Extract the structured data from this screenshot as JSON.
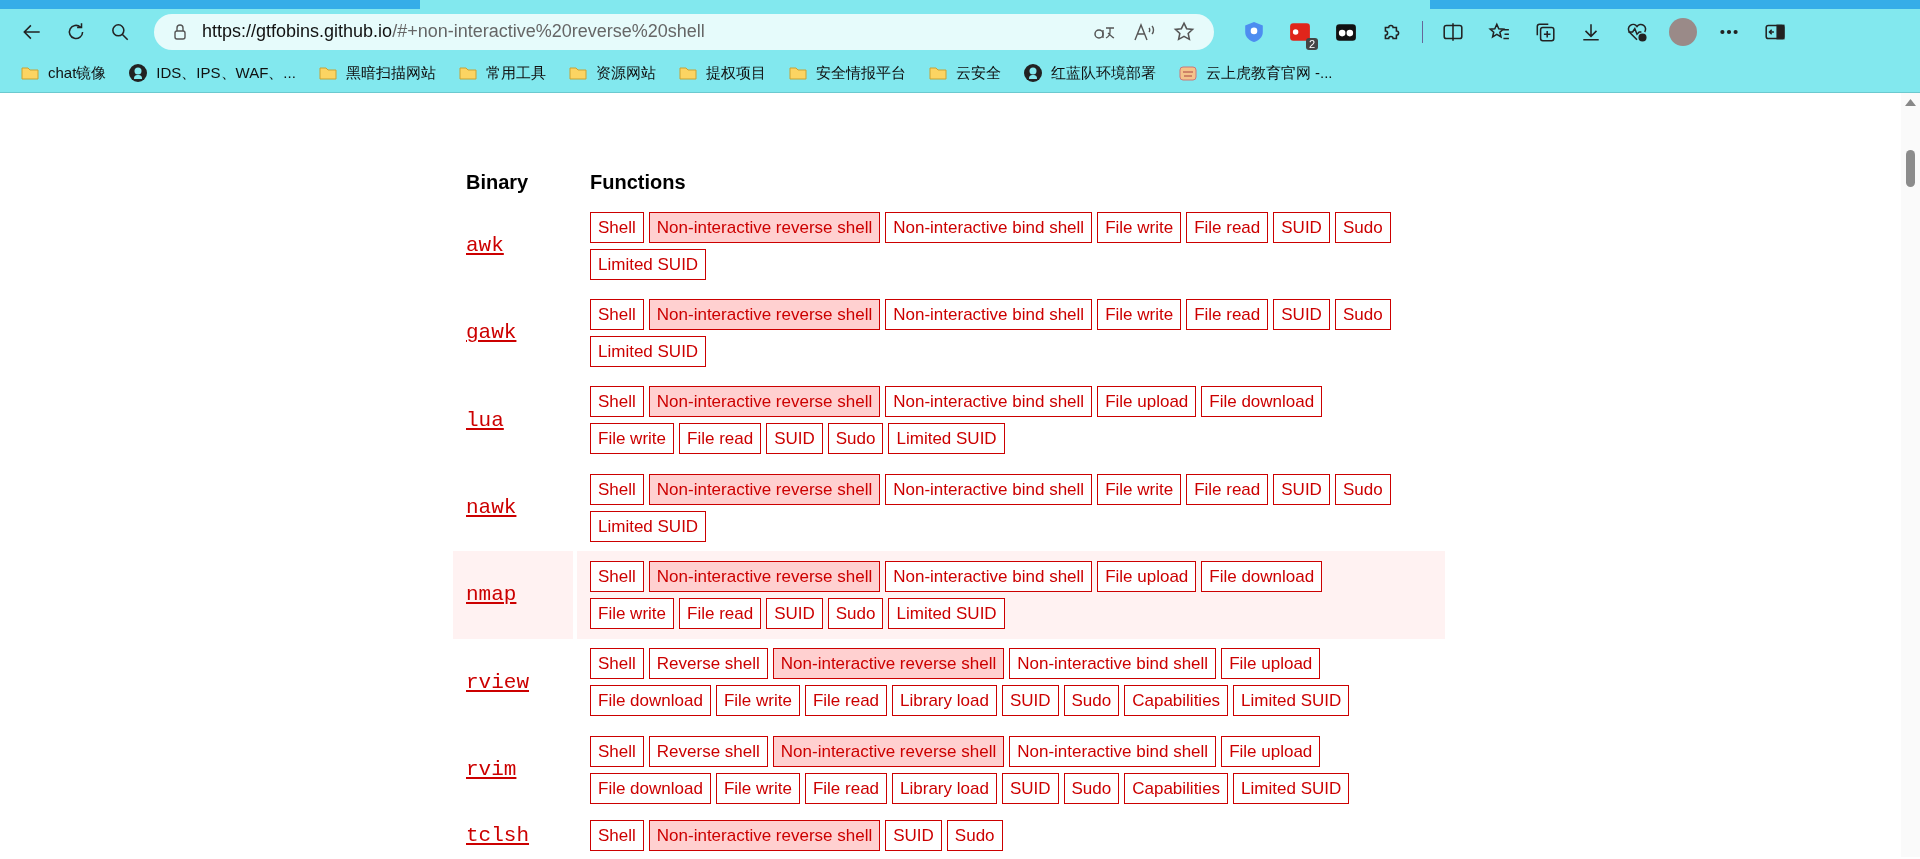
{
  "browser": {
    "url_host": "https://gtfobins.github.io",
    "url_rest": "/#+non-interactive%20reverse%20shell",
    "extension_badge": "2"
  },
  "bookmarks": [
    {
      "kind": "folder",
      "label": "chat镜像"
    },
    {
      "kind": "github",
      "label": "IDS、IPS、WAF、..."
    },
    {
      "kind": "folder",
      "label": "黑暗扫描网站"
    },
    {
      "kind": "folder",
      "label": "常用工具"
    },
    {
      "kind": "folder",
      "label": "资源网站"
    },
    {
      "kind": "folder",
      "label": "提权项目"
    },
    {
      "kind": "folder",
      "label": "安全情报平台"
    },
    {
      "kind": "folder",
      "label": "云安全"
    },
    {
      "kind": "github",
      "label": "红蓝队环境部署"
    },
    {
      "kind": "site",
      "label": "云上虎教育官网 -..."
    }
  ],
  "table": {
    "columns": [
      "Binary",
      "Functions"
    ],
    "rows": [
      {
        "binary": "awk",
        "highlighted": false,
        "functions": [
          {
            "label": "Shell",
            "selected": false
          },
          {
            "label": "Non-interactive reverse shell",
            "selected": true
          },
          {
            "label": "Non-interactive bind shell",
            "selected": false
          },
          {
            "label": "File write",
            "selected": false
          },
          {
            "label": "File read",
            "selected": false
          },
          {
            "label": "SUID",
            "selected": false
          },
          {
            "label": "Sudo",
            "selected": false
          },
          {
            "label": "Limited SUID",
            "selected": false
          }
        ]
      },
      {
        "binary": "gawk",
        "highlighted": false,
        "functions": [
          {
            "label": "Shell",
            "selected": false
          },
          {
            "label": "Non-interactive reverse shell",
            "selected": true
          },
          {
            "label": "Non-interactive bind shell",
            "selected": false
          },
          {
            "label": "File write",
            "selected": false
          },
          {
            "label": "File read",
            "selected": false
          },
          {
            "label": "SUID",
            "selected": false
          },
          {
            "label": "Sudo",
            "selected": false
          },
          {
            "label": "Limited SUID",
            "selected": false
          }
        ]
      },
      {
        "binary": "lua",
        "highlighted": false,
        "functions": [
          {
            "label": "Shell",
            "selected": false
          },
          {
            "label": "Non-interactive reverse shell",
            "selected": true
          },
          {
            "label": "Non-interactive bind shell",
            "selected": false
          },
          {
            "label": "File upload",
            "selected": false
          },
          {
            "label": "File download",
            "selected": false
          },
          {
            "label": "File write",
            "selected": false
          },
          {
            "label": "File read",
            "selected": false
          },
          {
            "label": "SUID",
            "selected": false
          },
          {
            "label": "Sudo",
            "selected": false
          },
          {
            "label": "Limited SUID",
            "selected": false
          }
        ]
      },
      {
        "binary": "nawk",
        "highlighted": false,
        "functions": [
          {
            "label": "Shell",
            "selected": false
          },
          {
            "label": "Non-interactive reverse shell",
            "selected": true
          },
          {
            "label": "Non-interactive bind shell",
            "selected": false
          },
          {
            "label": "File write",
            "selected": false
          },
          {
            "label": "File read",
            "selected": false
          },
          {
            "label": "SUID",
            "selected": false
          },
          {
            "label": "Sudo",
            "selected": false
          },
          {
            "label": "Limited SUID",
            "selected": false
          }
        ]
      },
      {
        "binary": "nmap",
        "highlighted": true,
        "functions": [
          {
            "label": "Shell",
            "selected": false
          },
          {
            "label": "Non-interactive reverse shell",
            "selected": true
          },
          {
            "label": "Non-interactive bind shell",
            "selected": false
          },
          {
            "label": "File upload",
            "selected": false
          },
          {
            "label": "File download",
            "selected": false
          },
          {
            "label": "File write",
            "selected": false
          },
          {
            "label": "File read",
            "selected": false
          },
          {
            "label": "SUID",
            "selected": false
          },
          {
            "label": "Sudo",
            "selected": false
          },
          {
            "label": "Limited SUID",
            "selected": false
          }
        ]
      },
      {
        "binary": "rview",
        "highlighted": false,
        "functions": [
          {
            "label": "Shell",
            "selected": false
          },
          {
            "label": "Reverse shell",
            "selected": false
          },
          {
            "label": "Non-interactive reverse shell",
            "selected": true
          },
          {
            "label": "Non-interactive bind shell",
            "selected": false
          },
          {
            "label": "File upload",
            "selected": false
          },
          {
            "label": "File download",
            "selected": false
          },
          {
            "label": "File write",
            "selected": false
          },
          {
            "label": "File read",
            "selected": false
          },
          {
            "label": "Library load",
            "selected": false
          },
          {
            "label": "SUID",
            "selected": false
          },
          {
            "label": "Sudo",
            "selected": false
          },
          {
            "label": "Capabilities",
            "selected": false
          },
          {
            "label": "Limited SUID",
            "selected": false
          }
        ]
      },
      {
        "binary": "rvim",
        "highlighted": false,
        "functions": [
          {
            "label": "Shell",
            "selected": false
          },
          {
            "label": "Reverse shell",
            "selected": false
          },
          {
            "label": "Non-interactive reverse shell",
            "selected": true
          },
          {
            "label": "Non-interactive bind shell",
            "selected": false
          },
          {
            "label": "File upload",
            "selected": false
          },
          {
            "label": "File download",
            "selected": false
          },
          {
            "label": "File write",
            "selected": false
          },
          {
            "label": "File read",
            "selected": false
          },
          {
            "label": "Library load",
            "selected": false
          },
          {
            "label": "SUID",
            "selected": false
          },
          {
            "label": "Sudo",
            "selected": false
          },
          {
            "label": "Capabilities",
            "selected": false
          },
          {
            "label": "Limited SUID",
            "selected": false
          }
        ]
      },
      {
        "binary": "tclsh",
        "highlighted": false,
        "functions": [
          {
            "label": "Shell",
            "selected": false
          },
          {
            "label": "Non-interactive reverse shell",
            "selected": true
          },
          {
            "label": "SUID",
            "selected": false
          },
          {
            "label": "Sudo",
            "selected": false
          }
        ]
      }
    ]
  }
}
